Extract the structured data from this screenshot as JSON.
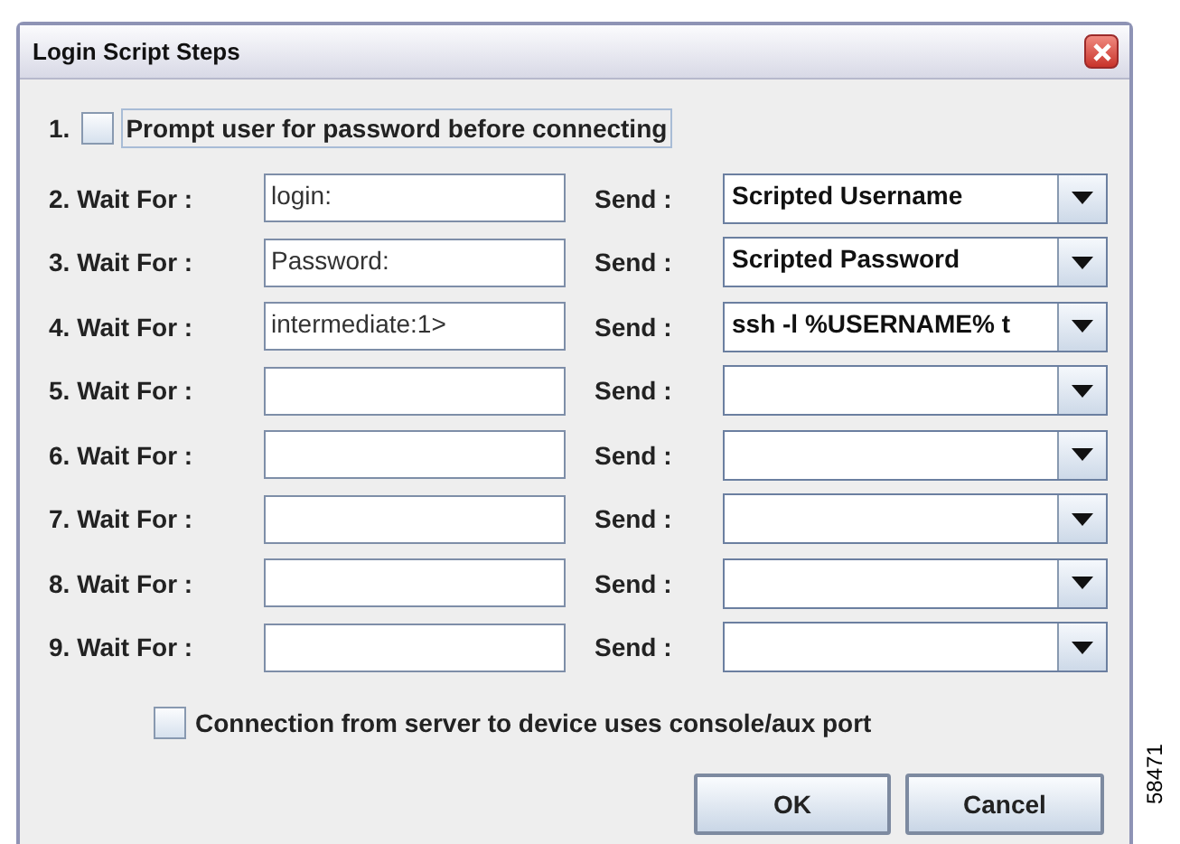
{
  "window": {
    "title": "Login Script Steps"
  },
  "prompt_option": {
    "number": "1.",
    "label": "Prompt user for password before connecting",
    "checked": false,
    "focused": true
  },
  "steps": [
    {
      "label": "2. Wait For :",
      "wait_value": "login:",
      "send_label": "Send :",
      "send_value": "Scripted Username"
    },
    {
      "label": "3. Wait For :",
      "wait_value": "Password:",
      "send_label": "Send :",
      "send_value": "Scripted Password"
    },
    {
      "label": "4. Wait For :",
      "wait_value": "intermediate:1>",
      "send_label": "Send :",
      "send_value": "ssh -l %USERNAME% t"
    },
    {
      "label": "5. Wait For :",
      "send_label": "Send :"
    },
    {
      "label": "6. Wait For :",
      "send_label": "Send :"
    },
    {
      "label": "7. Wait For :",
      "send_label": "Send :"
    },
    {
      "label": "8. Wait For :",
      "send_label": "Send :"
    },
    {
      "label": "9. Wait For :",
      "send_label": "Send :"
    }
  ],
  "console_option": {
    "label": "Connection from server to device uses console/aux port",
    "checked": false
  },
  "buttons": [
    "OK",
    "Cancel"
  ],
  "figure_number": "58471"
}
